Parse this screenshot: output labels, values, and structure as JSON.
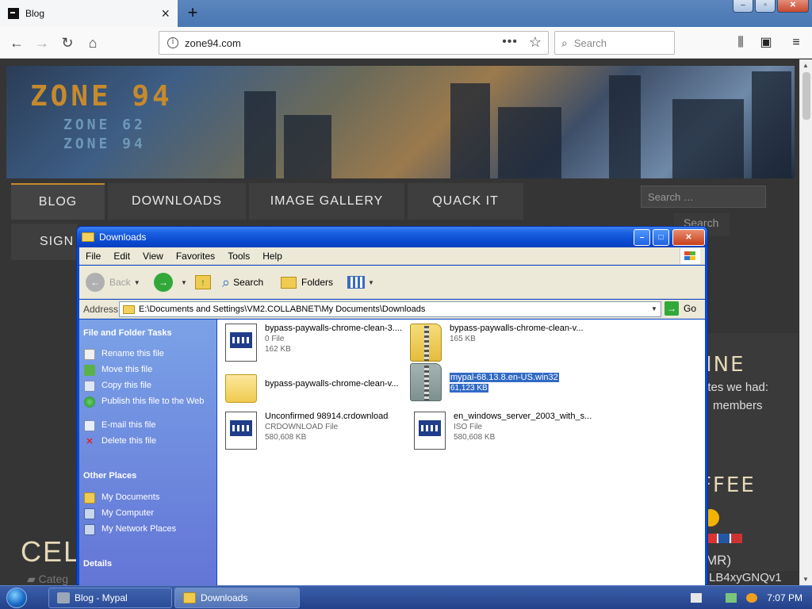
{
  "browser": {
    "tab_title": "Blog",
    "new_tab": "+",
    "url": "zone94.com",
    "search_placeholder": "Search"
  },
  "site": {
    "logo_main": "ZONE 94",
    "logo_sub1": "ZONE 62",
    "logo_sub2": "ZONE 94",
    "nav": [
      "BLOG",
      "DOWNLOADS",
      "IMAGE GALLERY",
      "QUACK IT"
    ],
    "nav_second": "SIGN",
    "search_placeholder": "Search …",
    "search_button": "Search",
    "side_heading_1": "INE",
    "side_text_1": "utes we had:",
    "side_text_2": "members",
    "side_heading_2": "FFEE",
    "side_text_3": "MR)",
    "side_text_4": "LB4xyGNQv1",
    "big_heading": "CELL",
    "category": "Categ"
  },
  "explorer": {
    "title": "Downloads",
    "menu": [
      "File",
      "Edit",
      "View",
      "Favorites",
      "Tools",
      "Help"
    ],
    "toolbar": {
      "back": "Back",
      "search": "Search",
      "folders": "Folders"
    },
    "address_label": "Address",
    "address_path": "E:\\Documents and Settings\\VM2.COLLABNET\\My Documents\\Downloads",
    "go_label": "Go",
    "tasks_heading": "File and Folder Tasks",
    "tasks": [
      "Rename this file",
      "Move this file",
      "Copy this file",
      "Publish this file to the Web",
      "E-mail this file",
      "Delete this file"
    ],
    "places_heading": "Other Places",
    "places": [
      "My Documents",
      "My Computer",
      "My Network Places"
    ],
    "details_heading": "Details",
    "files": [
      {
        "name": "bypass-paywalls-chrome-clean-3....",
        "type": "0 File",
        "size": "162 KB"
      },
      {
        "name": "bypass-paywalls-chrome-clean-v...",
        "type": "",
        "size": "165 KB"
      },
      {
        "name": "bypass-paywalls-chrome-clean-v...",
        "type": "",
        "size": ""
      },
      {
        "name": "mypal-68.13.8.en-US.win32",
        "type": "",
        "size": "61,123 KB"
      },
      {
        "name": "Unconfirmed 98914.crdownload",
        "type": "CRDOWNLOAD File",
        "size": "580,608 KB"
      },
      {
        "name": "en_windows_server_2003_with_s...",
        "type": "ISO File",
        "size": "580,608 KB"
      }
    ]
  },
  "taskbar": {
    "items": [
      "Blog - Mypal",
      "Downloads"
    ],
    "time": "7:07 PM"
  }
}
